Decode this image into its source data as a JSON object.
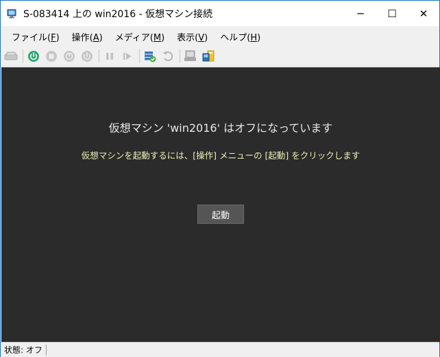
{
  "window": {
    "title": "S-083414 上の win2016 - 仮想マシン接続",
    "minimize_glyph": "─",
    "maximize_glyph": "☐",
    "close_glyph": "✕"
  },
  "menu": {
    "items": [
      {
        "label": "ファイル(",
        "key": "F",
        "suffix": ")"
      },
      {
        "label": "操作(",
        "key": "A",
        "suffix": ")"
      },
      {
        "label": "メディア(",
        "key": "M",
        "suffix": ")"
      },
      {
        "label": "表示(",
        "key": "V",
        "suffix": ")"
      },
      {
        "label": "ヘルプ(",
        "key": "H",
        "suffix": ")"
      }
    ]
  },
  "toolbar": {
    "icons": [
      "ctrl-alt-del-icon",
      "start-icon",
      "turn-off-icon",
      "shutdown-icon",
      "power-icon",
      "pause-icon",
      "resume-icon",
      "checkpoint-icon",
      "revert-icon",
      "enhanced-session-icon",
      "share-icon"
    ]
  },
  "content": {
    "headline": "仮想マシン 'win2016' はオフになっています",
    "instruction": "仮想マシンを起動するには、[操作] メニューの [起動] をクリックします",
    "start_button": "起動"
  },
  "status": {
    "text": "状態: オフ"
  },
  "colors": {
    "background": "#2b2b2b",
    "start_icon": "#2aa572",
    "instruction_text": "#f2f0b8"
  }
}
